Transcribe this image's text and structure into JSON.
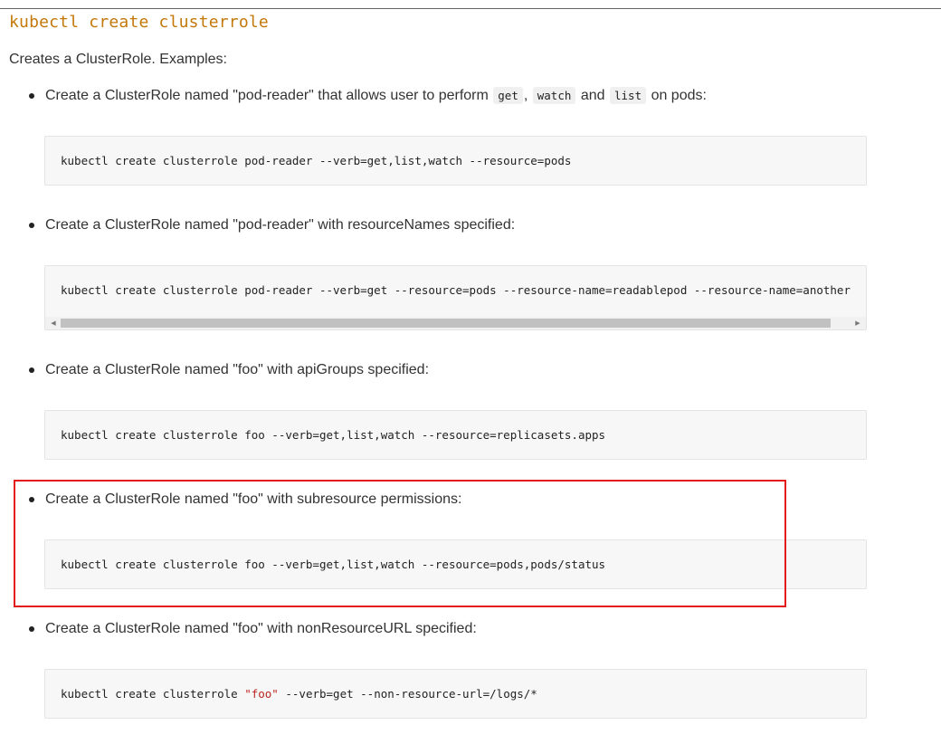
{
  "heading": "kubectl create clusterrole",
  "intro": "Creates a ClusterRole. Examples:",
  "examples": [
    {
      "pre": "Create a ClusterRole named \"pod-reader\" that allows user to perform",
      "code1": "get",
      "sep1": ",",
      "code2": "watch",
      "and": "and",
      "code3": "list",
      "post": "on pods:",
      "command": "kubectl create clusterrole pod-reader --verb=get,list,watch --resource=pods"
    },
    {
      "text": "Create a ClusterRole named \"pod-reader\" with resourceNames specified:",
      "command": "kubectl create clusterrole pod-reader --verb=get --resource=pods --resource-name=readablepod --resource-name=another"
    },
    {
      "text": "Create a ClusterRole named \"foo\" with apiGroups specified:",
      "command": "kubectl create clusterrole foo --verb=get,list,watch --resource=replicasets.apps"
    },
    {
      "text": "Create a ClusterRole named \"foo\" with subresource permissions:",
      "command": "kubectl create clusterrole foo --verb=get,list,watch --resource=pods,pods/status"
    },
    {
      "text": "Create a ClusterRole named \"foo\" with nonResourceURL specified:",
      "command_pre": "kubectl create clusterrole ",
      "command_str": "\"foo\"",
      "command_post": " --verb=get --non-resource-url=/logs/*"
    }
  ],
  "scrollbar": {
    "left_arrow": "◀",
    "right_arrow": "▶"
  },
  "colors": {
    "heading": "#c4780a",
    "highlight": "#e31b1b",
    "code_background": "#f7f7f7",
    "string_literal": "#b8271f"
  }
}
